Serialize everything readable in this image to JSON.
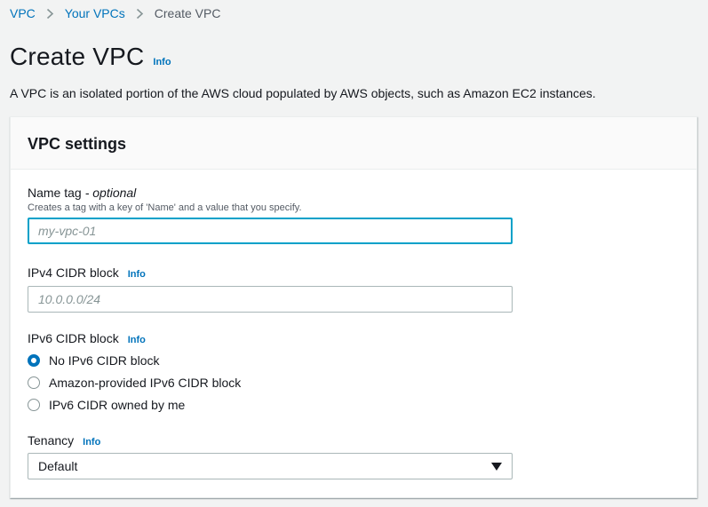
{
  "breadcrumb": {
    "items": [
      {
        "label": "VPC",
        "link": true
      },
      {
        "label": "Your VPCs",
        "link": true
      },
      {
        "label": "Create VPC",
        "link": false
      }
    ]
  },
  "page": {
    "title": "Create VPC",
    "info": "Info",
    "description": "A VPC is an isolated portion of the AWS cloud populated by AWS objects, such as Amazon EC2 instances."
  },
  "panel": {
    "title": "VPC settings",
    "name_tag": {
      "label": "Name tag",
      "optional": "- optional",
      "description": "Creates a tag with a key of 'Name' and a value that you specify.",
      "placeholder": "my-vpc-01",
      "value": ""
    },
    "ipv4": {
      "label": "IPv4 CIDR block",
      "info": "Info",
      "placeholder": "10.0.0.0/24",
      "value": ""
    },
    "ipv6": {
      "label": "IPv6 CIDR block",
      "info": "Info",
      "options": [
        {
          "label": "No IPv6 CIDR block",
          "checked": true
        },
        {
          "label": "Amazon-provided IPv6 CIDR block",
          "checked": false
        },
        {
          "label": "IPv6 CIDR owned by me",
          "checked": false
        }
      ]
    },
    "tenancy": {
      "label": "Tenancy",
      "info": "Info",
      "selected": "Default"
    }
  },
  "colors": {
    "link": "#0073bb",
    "focus_border": "#00a1c9",
    "page_bg": "#f2f3f3"
  }
}
